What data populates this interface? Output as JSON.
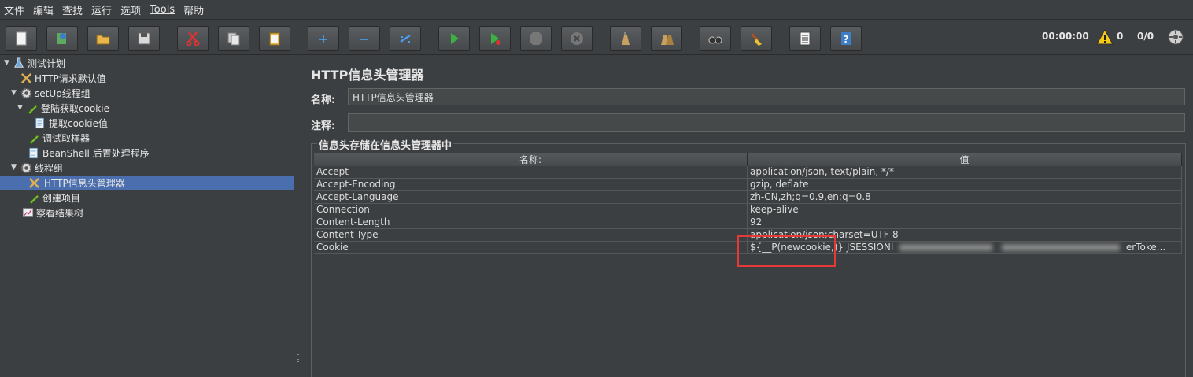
{
  "menu": [
    {
      "label": "文件"
    },
    {
      "label": "编辑"
    },
    {
      "label": "查找"
    },
    {
      "label": "运行"
    },
    {
      "label": "选项"
    },
    {
      "label": "Tools"
    },
    {
      "label": "帮助"
    }
  ],
  "toolbar": {
    "icons": [
      "new-icon",
      "templates-icon",
      "open-icon",
      "save-icon",
      "cut-icon",
      "copy-icon",
      "paste-icon",
      "expand-icon",
      "collapse-icon",
      "toggle-icon",
      "start-icon",
      "start-no-pause-icon",
      "stop-icon",
      "shutdown-icon",
      "clear-icon",
      "clear-all-icon",
      "search-icon",
      "reset-search-icon",
      "function-helper-icon",
      "help-icon"
    ],
    "timer": "00:00:00",
    "warnings": "0",
    "threads": "0/0"
  },
  "tree": {
    "nodes": [
      {
        "label": "测试计划",
        "icon": "test-plan-icon",
        "toggle": "▼"
      },
      {
        "label": "HTTP请求默认值",
        "icon": "config-tool-icon",
        "toggle": ""
      },
      {
        "label": "setUp线程组",
        "icon": "gear-icon",
        "toggle": "▼"
      },
      {
        "label": "登陆获取cookie",
        "icon": "pen-icon",
        "toggle": "▼"
      },
      {
        "label": "提取cookie值",
        "icon": "document-icon",
        "toggle": ""
      },
      {
        "label": "调试取样器",
        "icon": "pen-icon",
        "toggle": ""
      },
      {
        "label": "BeanShell 后置处理程序",
        "icon": "document-icon",
        "toggle": ""
      },
      {
        "label": "线程组",
        "icon": "gear-icon",
        "toggle": "▼"
      },
      {
        "label": "HTTP信息头管理器",
        "icon": "config-tool-icon",
        "toggle": ""
      },
      {
        "label": "创建项目",
        "icon": "pen-icon",
        "toggle": ""
      },
      {
        "label": "察看结果树",
        "icon": "chart-icon",
        "toggle": ""
      }
    ],
    "selected": "HTTP信息头管理器"
  },
  "panel": {
    "title": "HTTP信息头管理器",
    "name_label": "名称:",
    "name_value": "HTTP信息头管理器",
    "comment_label": "注释:",
    "comment_value": "",
    "group_label": "信息头存储在信息头管理器中",
    "columns": [
      "名称:",
      "值"
    ],
    "rows": [
      {
        "name": "Accept",
        "value": "application/json, text/plain, */*"
      },
      {
        "name": "Accept-Encoding",
        "value": "gzip, deflate"
      },
      {
        "name": "Accept-Language",
        "value": "zh-CN,zh;q=0.9,en;q=0.8"
      },
      {
        "name": "Connection",
        "value": "keep-alive"
      },
      {
        "name": "Content-Length",
        "value": "92"
      },
      {
        "name": "Content-Type",
        "value": "application/json;charset=UTF-8"
      },
      {
        "name": "Cookie",
        "value": "${__P(newcookie,)}",
        "value_visible_a": "JSESSIONI",
        "value_visible_b": "erToke..."
      }
    ]
  },
  "colors": {
    "background": "#3c3f41",
    "selection": "#4b6eaf",
    "highlight_box": "#e53935"
  }
}
